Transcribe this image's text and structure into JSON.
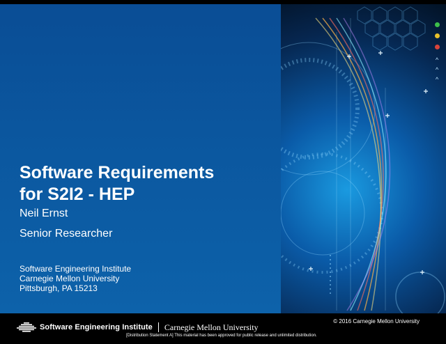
{
  "slide": {
    "title_line1": "Software Requirements",
    "title_line2": "for S2I2 - HEP",
    "presenter": "Neil Ernst",
    "role": "Senior Researcher",
    "address": {
      "line1": "Software Engineering Institute",
      "line2": "Carnegie Mellon University",
      "line3": "Pittsburgh, PA  15213"
    }
  },
  "footer": {
    "copyright": "© 2016 Carnegie Mellon University",
    "sei_name": "Software Engineering Institute",
    "cmu_name": "Carnegie Mellon University",
    "distribution": "[Distribution Statement A] This material has been approved for public release and unlimited distribution."
  },
  "colors": {
    "panel_blue": "#0b579f",
    "footer_black": "#000000",
    "text_white": "#ffffff",
    "window_green": "#3dbf4a",
    "window_yellow": "#e8c02b",
    "window_red": "#d9433a"
  },
  "icons": [
    "sei-logo-icon",
    "window-dot-icon",
    "caret-icon",
    "plus-icon"
  ]
}
